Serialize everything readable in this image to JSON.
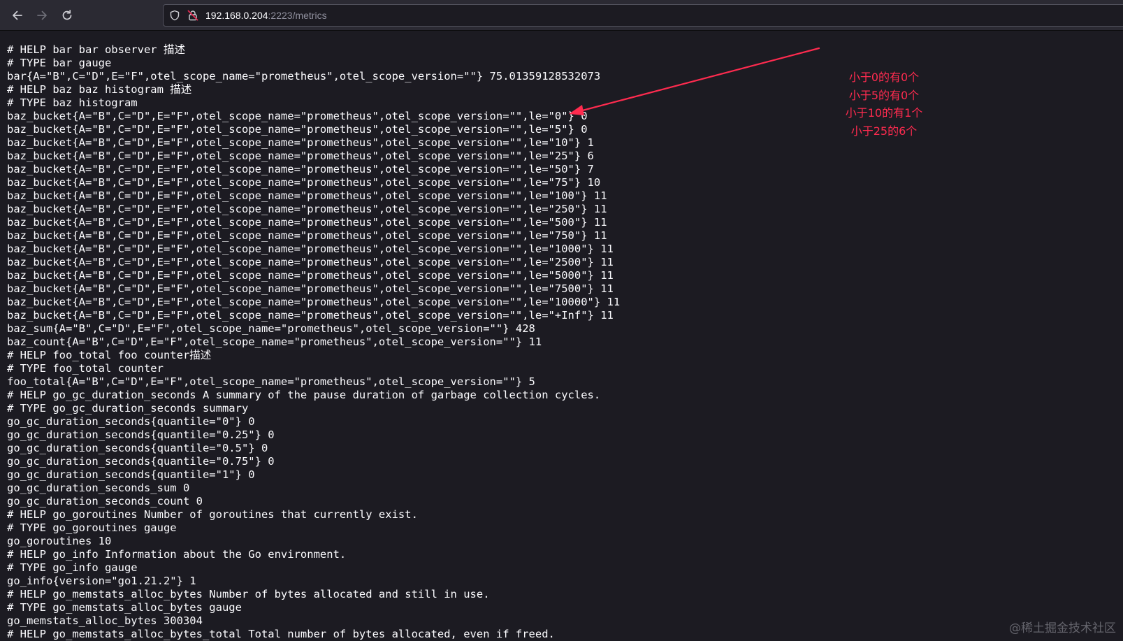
{
  "browser": {
    "url_host": "192.168.0.204",
    "url_rest": ":2223/metrics",
    "icons": {
      "back": "back-arrow-icon",
      "forward": "forward-arrow-icon",
      "reload": "reload-icon",
      "shield": "shield-icon",
      "insecure_lock": "insecure-lock-icon"
    }
  },
  "metrics": {
    "lines": [
      "# HELP bar bar observer 描述",
      "# TYPE bar gauge",
      "bar{A=\"B\",C=\"D\",E=\"F\",otel_scope_name=\"prometheus\",otel_scope_version=\"\"} 75.01359128532073",
      "# HELP baz baz histogram 描述",
      "# TYPE baz histogram",
      "baz_bucket{A=\"B\",C=\"D\",E=\"F\",otel_scope_name=\"prometheus\",otel_scope_version=\"\",le=\"0\"} 0",
      "baz_bucket{A=\"B\",C=\"D\",E=\"F\",otel_scope_name=\"prometheus\",otel_scope_version=\"\",le=\"5\"} 0",
      "baz_bucket{A=\"B\",C=\"D\",E=\"F\",otel_scope_name=\"prometheus\",otel_scope_version=\"\",le=\"10\"} 1",
      "baz_bucket{A=\"B\",C=\"D\",E=\"F\",otel_scope_name=\"prometheus\",otel_scope_version=\"\",le=\"25\"} 6",
      "baz_bucket{A=\"B\",C=\"D\",E=\"F\",otel_scope_name=\"prometheus\",otel_scope_version=\"\",le=\"50\"} 7",
      "baz_bucket{A=\"B\",C=\"D\",E=\"F\",otel_scope_name=\"prometheus\",otel_scope_version=\"\",le=\"75\"} 10",
      "baz_bucket{A=\"B\",C=\"D\",E=\"F\",otel_scope_name=\"prometheus\",otel_scope_version=\"\",le=\"100\"} 11",
      "baz_bucket{A=\"B\",C=\"D\",E=\"F\",otel_scope_name=\"prometheus\",otel_scope_version=\"\",le=\"250\"} 11",
      "baz_bucket{A=\"B\",C=\"D\",E=\"F\",otel_scope_name=\"prometheus\",otel_scope_version=\"\",le=\"500\"} 11",
      "baz_bucket{A=\"B\",C=\"D\",E=\"F\",otel_scope_name=\"prometheus\",otel_scope_version=\"\",le=\"750\"} 11",
      "baz_bucket{A=\"B\",C=\"D\",E=\"F\",otel_scope_name=\"prometheus\",otel_scope_version=\"\",le=\"1000\"} 11",
      "baz_bucket{A=\"B\",C=\"D\",E=\"F\",otel_scope_name=\"prometheus\",otel_scope_version=\"\",le=\"2500\"} 11",
      "baz_bucket{A=\"B\",C=\"D\",E=\"F\",otel_scope_name=\"prometheus\",otel_scope_version=\"\",le=\"5000\"} 11",
      "baz_bucket{A=\"B\",C=\"D\",E=\"F\",otel_scope_name=\"prometheus\",otel_scope_version=\"\",le=\"7500\"} 11",
      "baz_bucket{A=\"B\",C=\"D\",E=\"F\",otel_scope_name=\"prometheus\",otel_scope_version=\"\",le=\"10000\"} 11",
      "baz_bucket{A=\"B\",C=\"D\",E=\"F\",otel_scope_name=\"prometheus\",otel_scope_version=\"\",le=\"+Inf\"} 11",
      "baz_sum{A=\"B\",C=\"D\",E=\"F\",otel_scope_name=\"prometheus\",otel_scope_version=\"\"} 428",
      "baz_count{A=\"B\",C=\"D\",E=\"F\",otel_scope_name=\"prometheus\",otel_scope_version=\"\"} 11",
      "# HELP foo_total foo counter描述",
      "# TYPE foo_total counter",
      "foo_total{A=\"B\",C=\"D\",E=\"F\",otel_scope_name=\"prometheus\",otel_scope_version=\"\"} 5",
      "# HELP go_gc_duration_seconds A summary of the pause duration of garbage collection cycles.",
      "# TYPE go_gc_duration_seconds summary",
      "go_gc_duration_seconds{quantile=\"0\"} 0",
      "go_gc_duration_seconds{quantile=\"0.25\"} 0",
      "go_gc_duration_seconds{quantile=\"0.5\"} 0",
      "go_gc_duration_seconds{quantile=\"0.75\"} 0",
      "go_gc_duration_seconds{quantile=\"1\"} 0",
      "go_gc_duration_seconds_sum 0",
      "go_gc_duration_seconds_count 0",
      "# HELP go_goroutines Number of goroutines that currently exist.",
      "# TYPE go_goroutines gauge",
      "go_goroutines 10",
      "# HELP go_info Information about the Go environment.",
      "# TYPE go_info gauge",
      "go_info{version=\"go1.21.2\"} 1",
      "# HELP go_memstats_alloc_bytes Number of bytes allocated and still in use.",
      "# TYPE go_memstats_alloc_bytes gauge",
      "go_memstats_alloc_bytes 300304",
      "# HELP go_memstats_alloc_bytes_total Total number of bytes allocated, even if freed."
    ]
  },
  "annotation": {
    "lines": [
      "小于0的有0个",
      "小于5的有0个",
      "小于10的有1个",
      "小于25的6个"
    ],
    "color": "#ff2b4f"
  },
  "watermark": "@稀土掘金技术社区"
}
